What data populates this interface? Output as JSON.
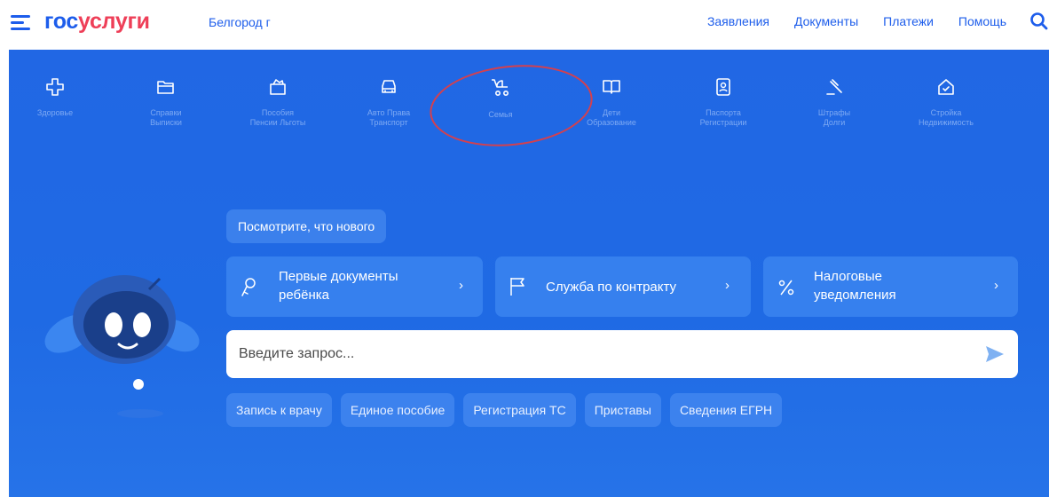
{
  "header": {
    "logo_part1": "гос",
    "logo_part2": "услуги",
    "region": "Белгород г",
    "nav": [
      "Заявления",
      "Документы",
      "Платежи",
      "Помощь"
    ]
  },
  "categories": [
    {
      "label": "Здоровье",
      "icon": "plus-cross-icon"
    },
    {
      "label": "Справки\nВыписки",
      "icon": "folder-icon"
    },
    {
      "label": "Пособия\nПенсии Льготы",
      "icon": "wallet-icon"
    },
    {
      "label": "Авто Права\nТранспорт",
      "icon": "car-icon"
    },
    {
      "label": "Семья",
      "icon": "stroller-icon"
    },
    {
      "label": "Дети\nОбразование",
      "icon": "book-icon"
    },
    {
      "label": "Паспорта\nРегистрации",
      "icon": "passport-icon"
    },
    {
      "label": "Штрафы\nДолги",
      "icon": "gavel-icon"
    },
    {
      "label": "Стройка\nНедвижимость",
      "icon": "house-icon"
    }
  ],
  "whats_new": "Посмотрите, что нового",
  "cards": [
    {
      "title_line1": "Первые документы",
      "title_line2": "ребёнка",
      "chevron": "›",
      "icon": "baby-rattle-icon"
    },
    {
      "title_line1": "Служба по контракту",
      "chevron": "›",
      "icon": "flag-icon"
    },
    {
      "title_line1": "Налоговые",
      "title_line2": "уведомления",
      "chevron": "›",
      "icon": "percent-icon"
    }
  ],
  "search": {
    "placeholder": "Введите запрос...",
    "value": ""
  },
  "chips": [
    "Запись к врачу",
    "Единое пособие",
    "Регистрация ТС",
    "Приставы",
    "Сведения ЕГРН"
  ],
  "colors": {
    "brand_blue": "#1d5deb",
    "brand_red": "#ee3f58",
    "panel_blue": "#1f68e3",
    "annotation_red": "#d4404e"
  }
}
